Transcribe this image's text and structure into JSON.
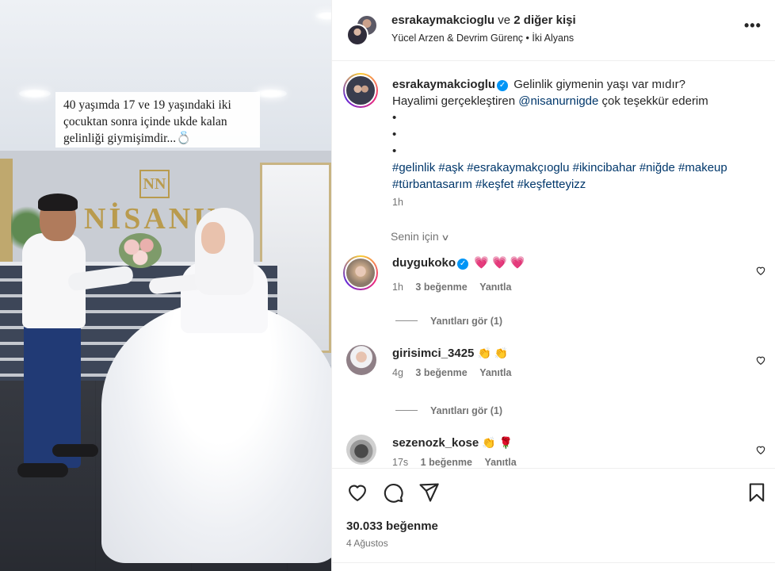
{
  "post": {
    "image_caption_line1": "40 yaşımda 17 ve 19 yaşındaki iki",
    "image_caption_line2": "çocuktan sonra içinde ukde kalan",
    "image_caption_line3": "gelinliği giymişimdir...💍",
    "logo_letters": "NN",
    "logo_text": "NİSANUR"
  },
  "header": {
    "username": "esrakaymakcioglu",
    "and_text": "ve",
    "others": "2 diğer kişi",
    "audio": "Yücel Arzen & Devrim Gürenç • İki Alyans",
    "more": "•••"
  },
  "caption": {
    "username": "esrakaymakcioglu",
    "verified": "✓",
    "line1": "Gelinlik giymenin yaşı var mıdır?",
    "line2_prefix": "Hayalimi gerçekleştiren",
    "mention": "@nisanurnigde",
    "line2_suffix": "çok teşekkür ederim",
    "bullets": [
      "•",
      "•",
      "•"
    ],
    "hashtags_line1": "#gelinlik #aşk #esrakaymakçıoglu #ikincibahar #niğde #makeup",
    "hashtags_line2": "#türbantasarım #keşfet #keşfetteyizz",
    "time": "1h"
  },
  "for_you": {
    "label": "Senin için",
    "chevron": "∨"
  },
  "comments": [
    {
      "username": "duygukoko",
      "verified": "✓",
      "text": "💗 💗 💗",
      "time": "1h",
      "likes": "3 beğenme",
      "reply": "Yanıtla",
      "see_replies": "Yanıtları gör (1)"
    },
    {
      "username": "girisimci_3425",
      "text": "👏 👏",
      "time": "4g",
      "likes": "3 beğenme",
      "reply": "Yanıtla",
      "see_replies": "Yanıtları gör (1)"
    },
    {
      "username": "sezenozk_kose",
      "text": "👏 🌹",
      "time": "17s",
      "likes": "1 beğenme",
      "reply": "Yanıtla"
    }
  ],
  "actions": {
    "likes": "30.033 beğenme",
    "date": "4 Ağustos"
  },
  "colors": {
    "link": "#00376b",
    "muted": "#737373",
    "verified": "#0095f6",
    "heart_emoji": "#e0245e"
  }
}
